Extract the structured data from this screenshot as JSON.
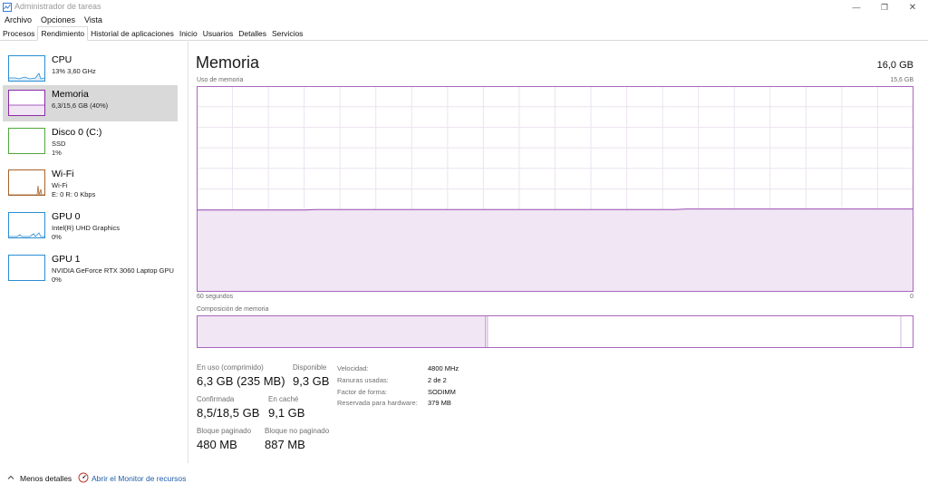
{
  "window": {
    "title": "Administrador de tareas",
    "minimize_glyph": "—",
    "restore_glyph": "❐",
    "close_glyph": "✕"
  },
  "menu": [
    "Archivo",
    "Opciones",
    "Vista"
  ],
  "tabs": [
    {
      "label": "Procesos",
      "active": false
    },
    {
      "label": "Rendimiento",
      "active": true
    },
    {
      "label": "Historial de aplicaciones",
      "active": false
    },
    {
      "label": "Inicio",
      "active": false
    },
    {
      "label": "Usuarios",
      "active": false
    },
    {
      "label": "Detalles",
      "active": false
    },
    {
      "label": "Servicios",
      "active": false
    }
  ],
  "sidebar": {
    "items": [
      {
        "title": "CPU",
        "line1": "13% 3,60 GHz",
        "line2": "",
        "color": "#2a8dd3",
        "selected": false
      },
      {
        "title": "Memoria",
        "line1": "6,3/15,6 GB (40%)",
        "line2": "",
        "color": "#8b2aa7",
        "selected": true
      },
      {
        "title": "Disco 0 (C:)",
        "line1": "SSD",
        "line2": "1%",
        "color": "#4fa83d",
        "selected": false
      },
      {
        "title": "Wi-Fi",
        "line1": "Wi-Fi",
        "line2": "E: 0 R: 0 Kbps",
        "color": "#a7622a",
        "selected": false
      },
      {
        "title": "GPU 0",
        "line1": "Intel(R) UHD Graphics",
        "line2": "0%",
        "color": "#2a8dd3",
        "selected": false
      },
      {
        "title": "GPU 1",
        "line1": "NVIDIA GeForce RTX 3060 Laptop GPU",
        "line2": "0%",
        "color": "#2a8dd3",
        "selected": false
      }
    ]
  },
  "main": {
    "title": "Memoria",
    "total": "16,0 GB",
    "usage_caption": "Uso de memoria",
    "usage_max": "15,6 GB",
    "time_left": "60 segundos",
    "time_right": "0",
    "composition_caption": "Composición de memoria",
    "usage_fraction": 0.4,
    "accent_color": "#8b2aa7"
  },
  "stats": {
    "in_use_label": "En uso (comprimido)",
    "in_use_value": "6,3 GB (235 MB)",
    "available_label": "Disponible",
    "available_value": "9,3 GB",
    "committed_label": "Confirmada",
    "committed_value": "8,5/18,5 GB",
    "cached_label": "En caché",
    "cached_value": "9,1 GB",
    "paged_label": "Bloque paginado",
    "paged_value": "480 MB",
    "nonpaged_label": "Bloque no paginado",
    "nonpaged_value": "887 MB"
  },
  "details": [
    {
      "label": "Velocidad:",
      "value": "4800 MHz"
    },
    {
      "label": "Ranuras usadas:",
      "value": "2 de 2"
    },
    {
      "label": "Factor de forma:",
      "value": "SODIMM"
    },
    {
      "label": "Reservada para hardware:",
      "value": "379 MB"
    }
  ],
  "footer": {
    "fewer_details": "Menos detalles",
    "resource_monitor": "Abrir el Monitor de recursos"
  }
}
